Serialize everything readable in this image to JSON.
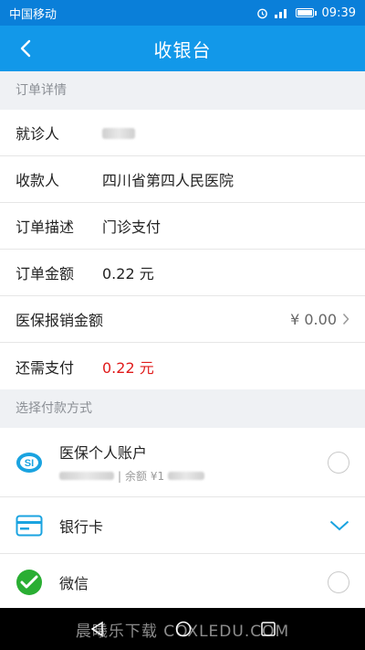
{
  "status_bar": {
    "carrier": "中国移动",
    "time": "09:39"
  },
  "header": {
    "title": "收银台"
  },
  "order_section": {
    "title": "订单详情",
    "rows": [
      {
        "label": "就诊人",
        "value": ""
      },
      {
        "label": "收款人",
        "value": "四川省第四人民医院"
      },
      {
        "label": "订单描述",
        "value": "门诊支付"
      },
      {
        "label": "订单金额",
        "value": "0.22 元"
      },
      {
        "label": "医保报销金额",
        "value": "¥ 0.00"
      },
      {
        "label": "还需支付",
        "value": "0.22 元"
      }
    ]
  },
  "payment_section": {
    "title": "选择付款方式",
    "methods": [
      {
        "name": "医保个人账户",
        "balance_label": "余额 ¥1"
      },
      {
        "name": "银行卡"
      },
      {
        "name": "微信"
      }
    ]
  },
  "watermark": "晨曦乐下载 COXLEDU.COM",
  "colors": {
    "header_blue": "#1298e9",
    "status_blue": "#0a7fd9",
    "red": "#e01b1b",
    "wechat_green": "#2aae33"
  }
}
